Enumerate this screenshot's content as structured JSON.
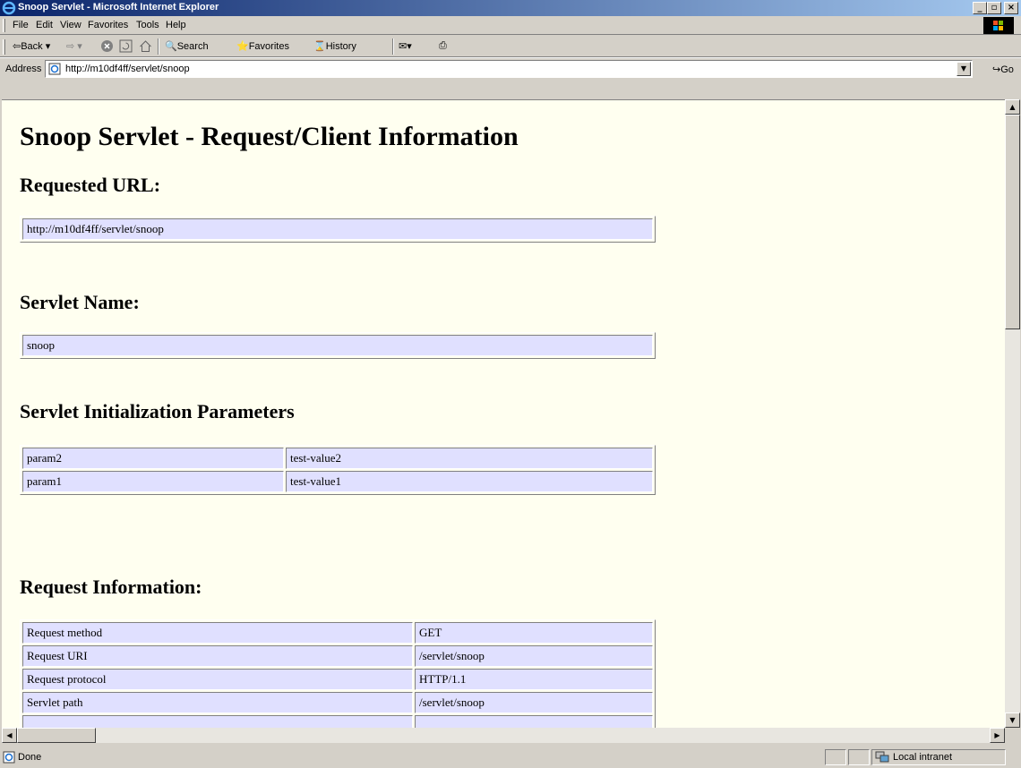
{
  "window": {
    "title": "Snoop Servlet - Microsoft Internet Explorer"
  },
  "menubar": [
    "File",
    "Edit",
    "View",
    "Favorites",
    "Tools",
    "Help"
  ],
  "toolbar": {
    "back": "Back",
    "search": "Search",
    "favorites": "Favorites",
    "history": "History"
  },
  "address": {
    "label": "Address",
    "url": "http://m10df4ff/servlet/snoop",
    "go": "Go"
  },
  "page": {
    "title": "Snoop Servlet - Request/Client Information",
    "requested_url_heading": "Requested URL:",
    "requested_url": "http://m10df4ff/servlet/snoop",
    "servlet_name_heading": "Servlet Name:",
    "servlet_name": "snoop",
    "init_params_heading": "Servlet Initialization Parameters",
    "init_params": [
      {
        "name": "param2",
        "value": "test-value2"
      },
      {
        "name": "param1",
        "value": "test-value1"
      }
    ],
    "request_info_heading": "Request Information:",
    "request_info": [
      {
        "name": "Request method",
        "value": "GET"
      },
      {
        "name": "Request URI",
        "value": "/servlet/snoop"
      },
      {
        "name": "Request protocol",
        "value": "HTTP/1.1"
      },
      {
        "name": "Servlet path",
        "value": "/servlet/snoop"
      }
    ]
  },
  "status": {
    "text": "Done",
    "zone": "Local intranet"
  },
  "colors": {
    "titlebar_start": "#0a246a",
    "titlebar_end": "#a6caf0",
    "page_bg": "#fffff0",
    "cell_bg": "#e0e0ff"
  }
}
